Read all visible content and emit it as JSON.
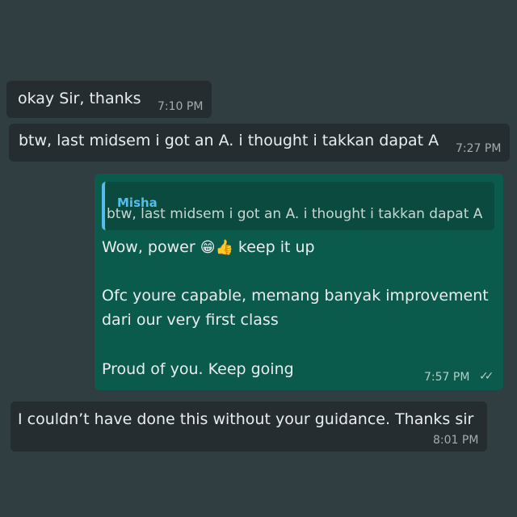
{
  "messages": [
    {
      "direction": "incoming",
      "text": "okay Sir, thanks",
      "time": "7:10 PM"
    },
    {
      "direction": "incoming",
      "text": "btw, last midsem i got an A. i thought i takkan dapat A",
      "time": "7:27 PM"
    },
    {
      "direction": "outgoing",
      "quote": {
        "author": "Misha",
        "text": "btw, last midsem i got an A. i thought i takkan dapat A"
      },
      "lines": {
        "l1_a": "Wow, power ",
        "l1_emoji": "😁👍",
        "l1_b": " keep it up",
        "l2": "Ofc youre capable, memang banyak improvement",
        "l3": "dari our very first class",
        "l4": "Proud of you. Keep going"
      },
      "time": "7:57 PM",
      "status_icon": "double-check-icon"
    },
    {
      "direction": "incoming",
      "text": "I couldn’t have done this without your guidance. Thanks sir",
      "time": "8:01 PM"
    }
  ],
  "colors": {
    "background": "#303e41",
    "incoming_bubble": "#262d31",
    "outgoing_bubble": "#0b5b4c",
    "quote_accent": "#53bdeb"
  }
}
